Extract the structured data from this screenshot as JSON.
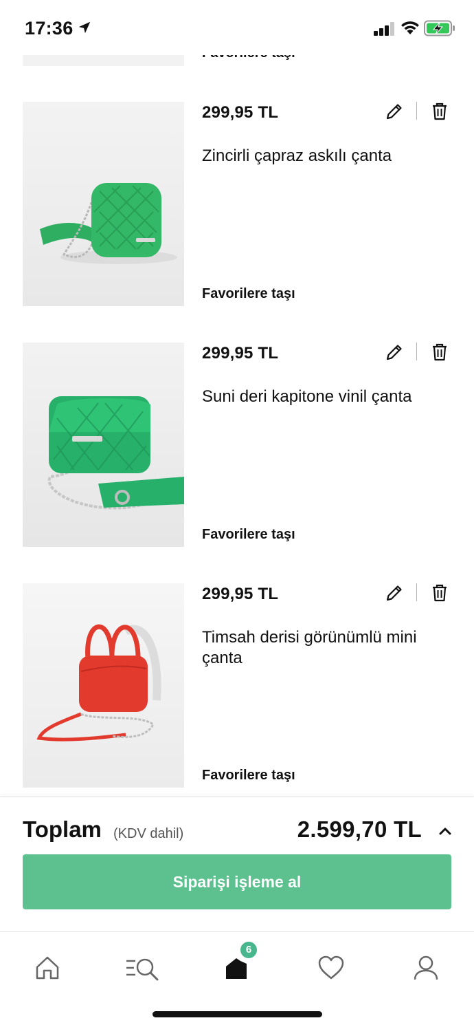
{
  "status_bar": {
    "time": "17:36",
    "icons": [
      "location-arrow-icon",
      "signal-icon",
      "wifi-icon",
      "battery-charging-icon"
    ]
  },
  "cart": {
    "previous_item_link": "Favorilere taşı",
    "items": [
      {
        "price": "299,95 TL",
        "title": "Zincirli çapraz askılı çanta",
        "move_to_favorites": "Favorilere taşı",
        "color": "#2fae61"
      },
      {
        "price": "299,95 TL",
        "title": "Suni deri kapitone vinil çanta",
        "move_to_favorites": "Favorilere taşı",
        "color": "#27b06a"
      },
      {
        "price": "299,95 TL",
        "title": "Timsah derisi görünümlü mini çanta",
        "move_to_favorites": "Favorilere taşı",
        "color": "#e23b2e"
      }
    ]
  },
  "summary": {
    "total_label": "Toplam",
    "tax_note": "(KDV dahil)",
    "total_amount": "2.599,70 TL",
    "checkout_label": "Siparişi işleme al",
    "accent_color": "#5cc18f"
  },
  "tab_bar": {
    "items": [
      "home-icon",
      "search-menu-icon",
      "bag-icon",
      "heart-icon",
      "account-icon"
    ],
    "bag_badge": "6",
    "badge_color": "#48b78d"
  }
}
